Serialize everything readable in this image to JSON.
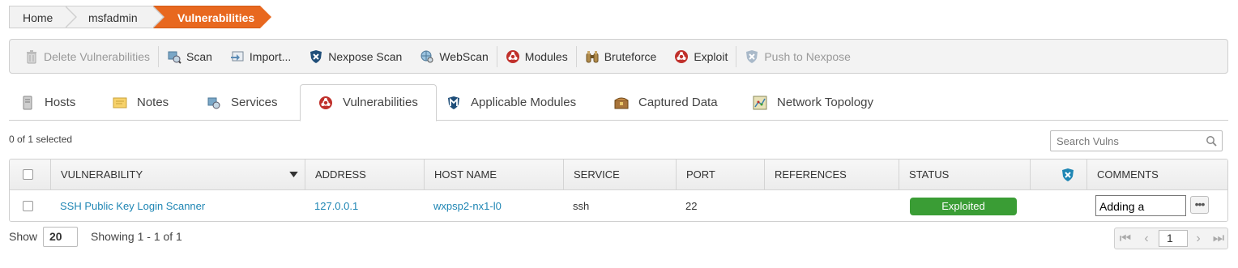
{
  "breadcrumb": {
    "home": "Home",
    "project": "msfadmin",
    "current": "Vulnerabilities"
  },
  "toolbar": {
    "delete_label": "Delete Vulnerabilities",
    "scan_label": "Scan",
    "import_label": "Import...",
    "nexpose_scan_label": "Nexpose Scan",
    "webscan_label": "WebScan",
    "modules_label": "Modules",
    "bruteforce_label": "Bruteforce",
    "exploit_label": "Exploit",
    "push_label": "Push to Nexpose"
  },
  "tabs": [
    {
      "label": "Hosts",
      "icon": "server-icon"
    },
    {
      "label": "Notes",
      "icon": "note-icon"
    },
    {
      "label": "Services",
      "icon": "services-icon"
    },
    {
      "label": "Vulnerabilities",
      "icon": "biohazard-icon",
      "active": true
    },
    {
      "label": "Applicable Modules",
      "icon": "metasploit-icon"
    },
    {
      "label": "Captured Data",
      "icon": "chest-icon"
    },
    {
      "label": "Network Topology",
      "icon": "topology-icon"
    }
  ],
  "selection": "0 of 1 selected",
  "search": {
    "placeholder": "Search Vulns"
  },
  "table": {
    "headers": {
      "vulnerability": "VULNERABILITY",
      "address": "ADDRESS",
      "host_name": "HOST NAME",
      "service": "SERVICE",
      "port": "PORT",
      "references": "REFERENCES",
      "status": "STATUS",
      "comments": "COMMENTS"
    },
    "rows": [
      {
        "vulnerability": "SSH Public Key Login Scanner",
        "address": "127.0.0.1",
        "host_name": "wxpsp2-nx1-l0",
        "service": "ssh",
        "port": "22",
        "references": "",
        "status": "Exploited",
        "comment": "Adding a"
      }
    ]
  },
  "footer": {
    "show_label": "Show",
    "page_size": "20",
    "showing": "Showing 1 - 1 of 1",
    "page": "1"
  },
  "colors": {
    "accent": "#e8681f",
    "link": "#1f86b4",
    "exploited": "#3a9d35"
  }
}
